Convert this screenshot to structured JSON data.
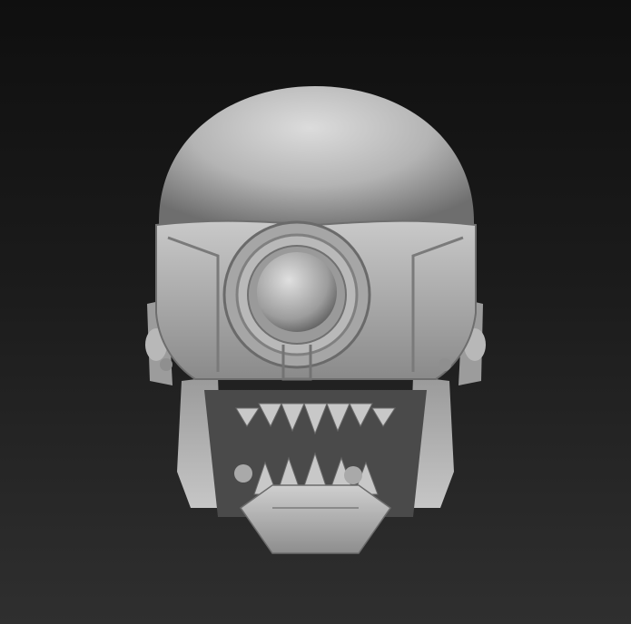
{
  "viewport": {
    "background_top": "#0f0f0f",
    "background_bottom": "#2f2f2f"
  },
  "model": {
    "subject": "helmet-head-sculpt",
    "material_color": "#bdbdbd",
    "shadow_color": "#3a3a3a"
  }
}
